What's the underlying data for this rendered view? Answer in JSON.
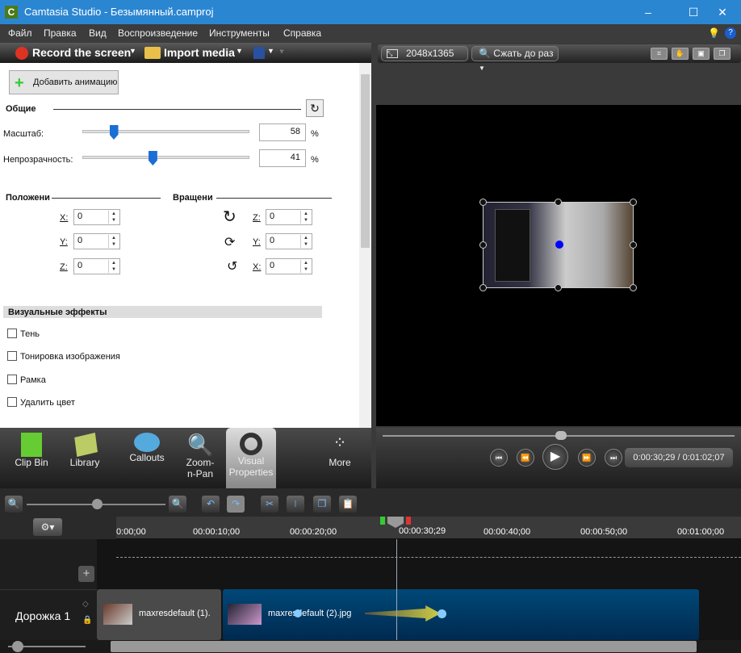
{
  "window": {
    "title": "Camtasia Studio - Безымянный.camproj",
    "logo": "C",
    "minimize": "–",
    "maximize": "☐",
    "close": "✕"
  },
  "menu": [
    "Файл",
    "Правка",
    "Вид",
    "Воспроизведение",
    "Инструменты",
    "Справка"
  ],
  "toolbar": {
    "record": "Record the screen",
    "import": "Import media"
  },
  "properties": {
    "add_animation": "Добавить анимацию",
    "general": "Общие",
    "scale_label": "Масштаб:",
    "scale_value": "58",
    "scale_percent": 58,
    "opacity_label": "Непрозрачность:",
    "opacity_value": "41",
    "opacity_percent": 41,
    "percent": "%",
    "position": "Положени",
    "rotation": "Вращени",
    "pos_x_label": "X:",
    "pos_x": "0",
    "pos_y_label": "Y:",
    "pos_y": "0",
    "pos_z_label": "Z:",
    "pos_z": "0",
    "rot_z_label": "Z:",
    "rot_z": "0",
    "rot_y_label": "Y:",
    "rot_y": "0",
    "rot_x_label": "X:",
    "rot_x": "0",
    "visual_effects": "Визуальные эффекты",
    "effects": [
      "Тень",
      "Тонировка изображения",
      "Рамка",
      "Удалить цвет"
    ]
  },
  "tabs": [
    {
      "label": "Clip Bin"
    },
    {
      "label": "Library"
    },
    {
      "label": "Callouts"
    },
    {
      "label": "Zoom-n-Pan"
    },
    {
      "label": "Visual Properties",
      "active": true
    },
    {
      "label": "More"
    }
  ],
  "preview": {
    "dimensions": "2048x1365",
    "zoom": "Сжать до раз",
    "time": "0:00:30;29 / 0:01:02;07",
    "progress_fraction": 0.49
  },
  "timeline": {
    "ruler": [
      "0:00;00",
      "00:00:10;00",
      "00:00:20;00",
      "00:00:30;29",
      "00:00:40;00",
      "00:00:50;00",
      "00:01:00;00"
    ],
    "track_name": "Дорожка 1",
    "clips": [
      "maxresdefault (1).",
      "maxresdefault (2).jpg"
    ]
  },
  "colors": {
    "title_bar": "#2b86d2",
    "accent": "#1a6fd6",
    "clip_selected": "#003a66"
  }
}
